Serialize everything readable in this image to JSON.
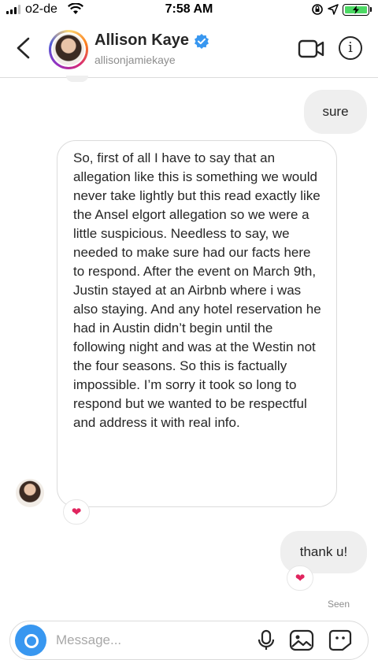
{
  "status_bar": {
    "carrier": "o2-de",
    "time": "7:58 AM"
  },
  "header": {
    "display_name": "Allison Kaye",
    "username": "allisonjamiekaye",
    "info_label": "i"
  },
  "messages": {
    "outgoing_1": "sure",
    "incoming_1": "So, first of all I have to say that an allegation like this is something we would never take lightly but this read exactly like the Ansel elgort allegation so we were a little suspicious. Needless to say, we needed to make sure had our facts here to respond. After the event on March 9th, Justin stayed at an Airbnb where i was also staying. And any hotel reservation he had in Austin didn’t begin until the following night and was at the Westin not the four seasons. So this is factually impossible. I’m sorry it took so long to respond but we wanted to be respectful and address it with real info.",
    "reaction_1": "❤",
    "outgoing_2": "thank u!",
    "reaction_2": "❤",
    "seen": "Seen"
  },
  "composer": {
    "placeholder": "Message..."
  },
  "colors": {
    "accent": "#3897f0",
    "bubble": "#efefef",
    "reaction": "#e0245e",
    "verified": "#3897f0"
  },
  "icons": [
    "back-chevron-icon",
    "verified-badge-icon",
    "video-camera-icon",
    "info-icon",
    "camera-icon",
    "microphone-icon",
    "gallery-icon",
    "sticker-icon",
    "heart-icon"
  ]
}
